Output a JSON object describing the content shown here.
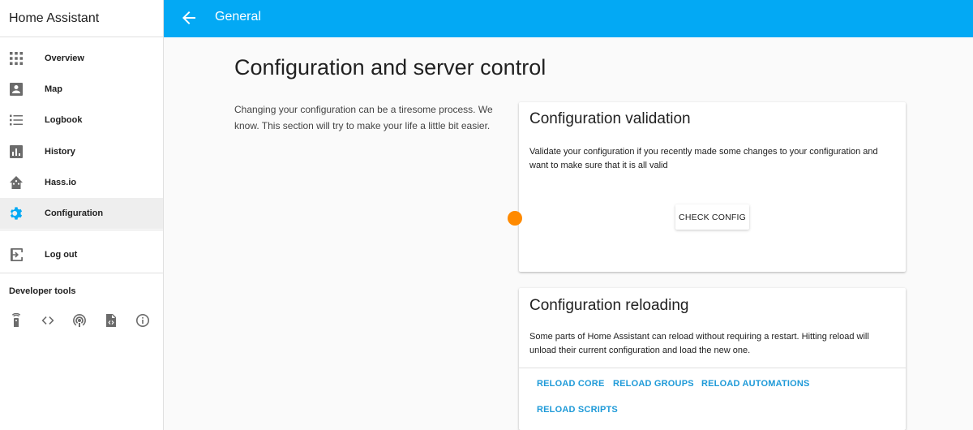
{
  "app": {
    "title": "Home Assistant"
  },
  "sidebar": {
    "items": [
      {
        "label": "Overview",
        "icon": "grid-icon"
      },
      {
        "label": "Map",
        "icon": "map-icon"
      },
      {
        "label": "Logbook",
        "icon": "list-icon"
      },
      {
        "label": "History",
        "icon": "chart-icon"
      },
      {
        "label": "Hass.io",
        "icon": "home-assistant-icon"
      },
      {
        "label": "Configuration",
        "icon": "gear-icon",
        "active": true
      }
    ],
    "logout": {
      "label": "Log out",
      "icon": "logout-icon"
    },
    "developer_tools": {
      "title": "Developer tools",
      "tools": [
        "remote-icon",
        "code-icon",
        "podcast-icon",
        "file-code-icon",
        "info-icon"
      ]
    }
  },
  "header": {
    "title": "General",
    "back_icon": "arrow-left-icon"
  },
  "main": {
    "title": "Configuration and server control",
    "intro": "Changing your configuration can be a tiresome process. We know. This section will try to make your life a little bit easier.",
    "validation": {
      "title": "Configuration validation",
      "text": "Validate your configuration if you recently made some changes to your configuration and want to make sure that it is all valid",
      "button": "CHECK CONFIG"
    },
    "reloading": {
      "title": "Configuration reloading",
      "text": "Some parts of Home Assistant can reload without requiring a restart. Hitting reload will unload their current configuration and load the new one.",
      "actions": [
        "RELOAD CORE",
        "RELOAD GROUPS",
        "RELOAD AUTOMATIONS",
        "RELOAD SCRIPTS"
      ]
    }
  },
  "colors": {
    "accent": "#03a9f4",
    "link": "#1e9ad8",
    "cursor": "#ff8a00"
  }
}
